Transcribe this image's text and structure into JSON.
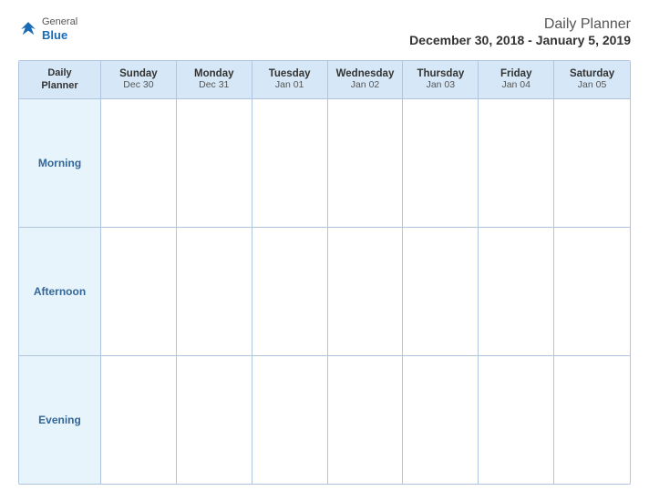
{
  "logo": {
    "general": "General",
    "blue": "Blue"
  },
  "title": {
    "main": "Daily Planner",
    "sub": "December 30, 2018 - January 5, 2019"
  },
  "header_row": {
    "label_line1": "Daily",
    "label_line2": "Planner",
    "days": [
      {
        "name": "Sunday",
        "date": "Dec 30"
      },
      {
        "name": "Monday",
        "date": "Dec 31"
      },
      {
        "name": "Tuesday",
        "date": "Jan 01"
      },
      {
        "name": "Wednesday",
        "date": "Jan 02"
      },
      {
        "name": "Thursday",
        "date": "Jan 03"
      },
      {
        "name": "Friday",
        "date": "Jan 04"
      },
      {
        "name": "Saturday",
        "date": "Jan 05"
      }
    ]
  },
  "rows": [
    {
      "label": "Morning"
    },
    {
      "label": "Afternoon"
    },
    {
      "label": "Evening"
    }
  ]
}
